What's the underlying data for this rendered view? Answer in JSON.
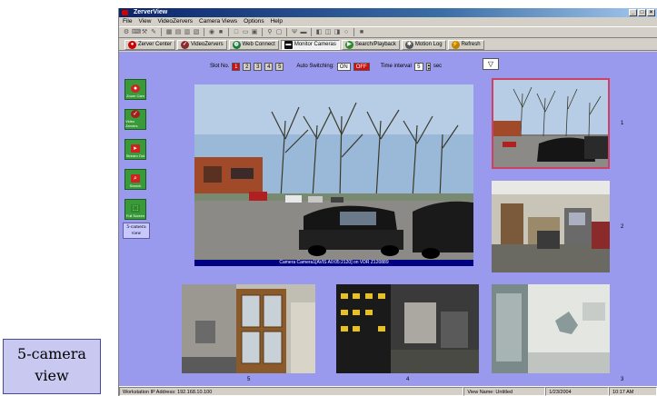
{
  "window": {
    "title": "ZerverView",
    "controls": [
      "_",
      "□",
      "×"
    ]
  },
  "menu": [
    "File",
    "View",
    "VideoZervers",
    "Camera Views",
    "Options",
    "Help"
  ],
  "navbar": [
    {
      "label": "Zerver Center",
      "icon": "zerver-center-icon",
      "color": "#cc0000"
    },
    {
      "label": "VideoZervers",
      "icon": "videozervers-icon",
      "color": "#8a2b2b"
    },
    {
      "label": "Web Connect",
      "icon": "web-globe-icon",
      "color": "#1a7a3a"
    },
    {
      "label": "Monitor Cameras",
      "icon": "monitor-icon",
      "color": "#111111"
    },
    {
      "label": "Search/Playback",
      "icon": "search-playback-icon",
      "color": "#2a8a2a"
    },
    {
      "label": "Motion Log",
      "icon": "motion-log-icon",
      "color": "#555555"
    },
    {
      "label": "Refresh",
      "icon": "refresh-icon",
      "color": "#c08000"
    }
  ],
  "controls": {
    "slot_label": "Slot No.",
    "slots": [
      "1",
      "2",
      "3",
      "4",
      "5"
    ],
    "active_slot": "1",
    "auto_label": "Auto Switching:",
    "on": "ON",
    "off": "OFF",
    "interval_label": "Time interval",
    "interval_value": "5",
    "interval_unit": "sec"
  },
  "left_tools": [
    {
      "label": "Zoom Cam",
      "icon": "zoom-camera-icon"
    },
    {
      "label": "Video Zervers",
      "icon": "video-zervers-icon"
    },
    {
      "label": "Stream Out",
      "icon": "stream-out-icon"
    },
    {
      "label": "Search",
      "icon": "search-icon"
    },
    {
      "label": "Full Screen",
      "icon": "full-screen-icon"
    }
  ],
  "view_label": [
    "5-camera",
    "view"
  ],
  "cameras": {
    "main_caption": "Camera Camera1[AVIS A0:05:2120] on VDR Z120889",
    "numbers": [
      "1",
      "2",
      "5",
      "4",
      "3"
    ]
  },
  "status": {
    "ip": "Workstation IP Address: 192.168.10.100",
    "view_name": "View Name: Untitled",
    "date": "1/23/2004",
    "time": "10:17 AM"
  },
  "callout": [
    "5-camera",
    "view"
  ]
}
